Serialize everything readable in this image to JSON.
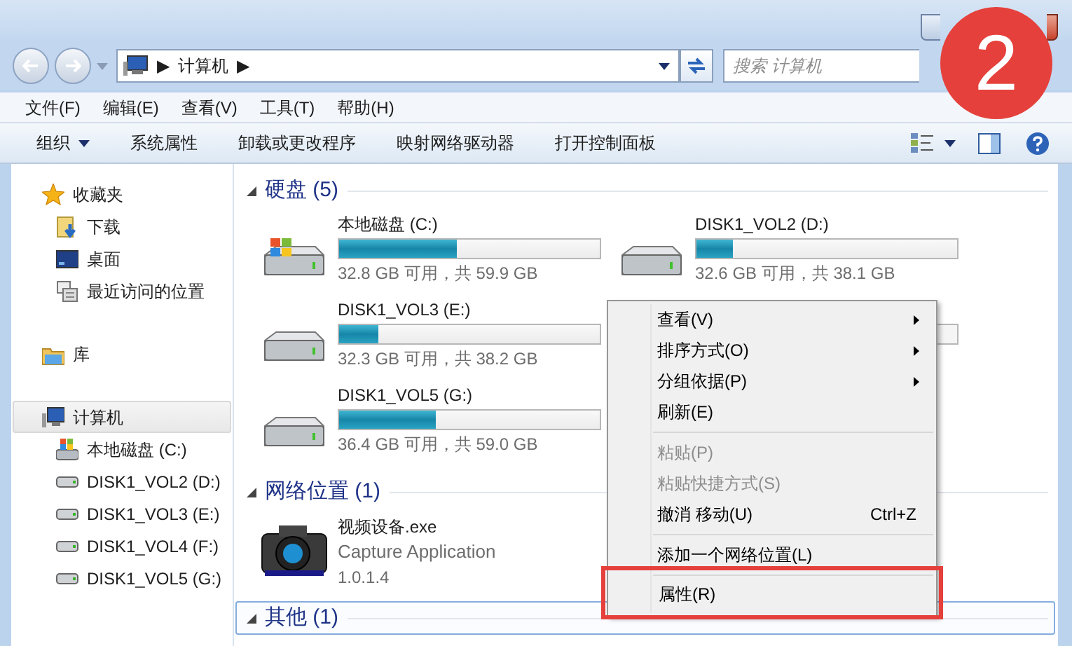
{
  "address_bar": {
    "crumbs": [
      "▶",
      "计算机",
      "▶"
    ]
  },
  "search": {
    "placeholder": "搜索 计算机"
  },
  "menu_bar": [
    "文件(F)",
    "编辑(E)",
    "查看(V)",
    "工具(T)",
    "帮助(H)"
  ],
  "toolbar": {
    "buttons": [
      {
        "label": "组织",
        "dropdown": true
      },
      {
        "label": "系统属性",
        "dropdown": false
      },
      {
        "label": "卸载或更改程序",
        "dropdown": false
      },
      {
        "label": "映射网络驱动器",
        "dropdown": false
      },
      {
        "label": "打开控制面板",
        "dropdown": false
      }
    ]
  },
  "sidebar": {
    "items": [
      {
        "label": "收藏夹",
        "kind": "star",
        "selected": false,
        "children": [
          {
            "label": "下载",
            "kind": "download",
            "selected": false
          },
          {
            "label": "桌面",
            "kind": "desktop",
            "selected": false
          },
          {
            "label": "最近访问的位置",
            "kind": "recent",
            "selected": false
          }
        ]
      },
      {
        "label": "库",
        "kind": "library",
        "selected": false
      },
      {
        "label": "计算机",
        "kind": "computer",
        "selected": true,
        "children": [
          {
            "label": "本地磁盘 (C:)",
            "kind": "sysdrive",
            "selected": false
          },
          {
            "label": "DISK1_VOL2 (D:)",
            "kind": "drive",
            "selected": false
          },
          {
            "label": "DISK1_VOL3 (E:)",
            "kind": "drive",
            "selected": false
          },
          {
            "label": "DISK1_VOL4 (F:)",
            "kind": "drive",
            "selected": false
          },
          {
            "label": "DISK1_VOL5 (G:)",
            "kind": "drive",
            "selected": false
          }
        ]
      }
    ]
  },
  "content": {
    "groups": [
      {
        "title": "硬盘 (5)",
        "selected": false,
        "items": [
          {
            "kind": "drive",
            "system": true,
            "name": "本地磁盘 (C:)",
            "level": 0.45,
            "info": "32.8 GB 可用，共 59.9 GB"
          },
          {
            "kind": "drive",
            "system": false,
            "name": "DISK1_VOL2 (D:)",
            "level": 0.14,
            "info": "32.6 GB 可用，共 38.1 GB"
          },
          {
            "kind": "drive",
            "system": false,
            "name": "DISK1_VOL3 (E:)",
            "level": 0.15,
            "info": "32.3 GB 可用，共 38.2 GB"
          },
          {
            "kind": "covered"
          },
          {
            "kind": "drive",
            "system": false,
            "name": "DISK1_VOL5 (G:)",
            "level": 0.37,
            "info": "36.4 GB 可用，共 59.0 GB"
          }
        ]
      },
      {
        "title": "网络位置 (1)",
        "selected": false,
        "items": [
          {
            "kind": "app",
            "name": "视频设备.exe",
            "description": "Capture Application",
            "version": "1.0.1.4"
          }
        ]
      },
      {
        "title": "其他 (1)",
        "selected": true
      }
    ]
  },
  "context_menu": {
    "items": [
      {
        "kind": "item",
        "label": "查看(V)",
        "submenu": true,
        "disabled": false,
        "highlighted": false
      },
      {
        "kind": "item",
        "label": "排序方式(O)",
        "submenu": true,
        "disabled": false,
        "highlighted": false
      },
      {
        "kind": "item",
        "label": "分组依据(P)",
        "submenu": true,
        "disabled": false,
        "highlighted": false
      },
      {
        "kind": "item",
        "label": "刷新(E)",
        "submenu": false,
        "disabled": false,
        "highlighted": false
      },
      {
        "kind": "separator"
      },
      {
        "kind": "item",
        "label": "粘贴(P)",
        "submenu": false,
        "disabled": true,
        "highlighted": false
      },
      {
        "kind": "item",
        "label": "粘贴快捷方式(S)",
        "submenu": false,
        "disabled": true,
        "highlighted": false
      },
      {
        "kind": "item",
        "label": "撤消 移动(U)",
        "shortcut": "Ctrl+Z",
        "submenu": false,
        "disabled": false,
        "highlighted": false
      },
      {
        "kind": "separator"
      },
      {
        "kind": "item",
        "label": "添加一个网络位置(L)",
        "submenu": false,
        "disabled": false,
        "highlighted": false
      },
      {
        "kind": "separator"
      },
      {
        "kind": "item",
        "label": "属性(R)",
        "submenu": false,
        "disabled": false,
        "highlighted": true
      }
    ]
  },
  "step_badge": "2"
}
